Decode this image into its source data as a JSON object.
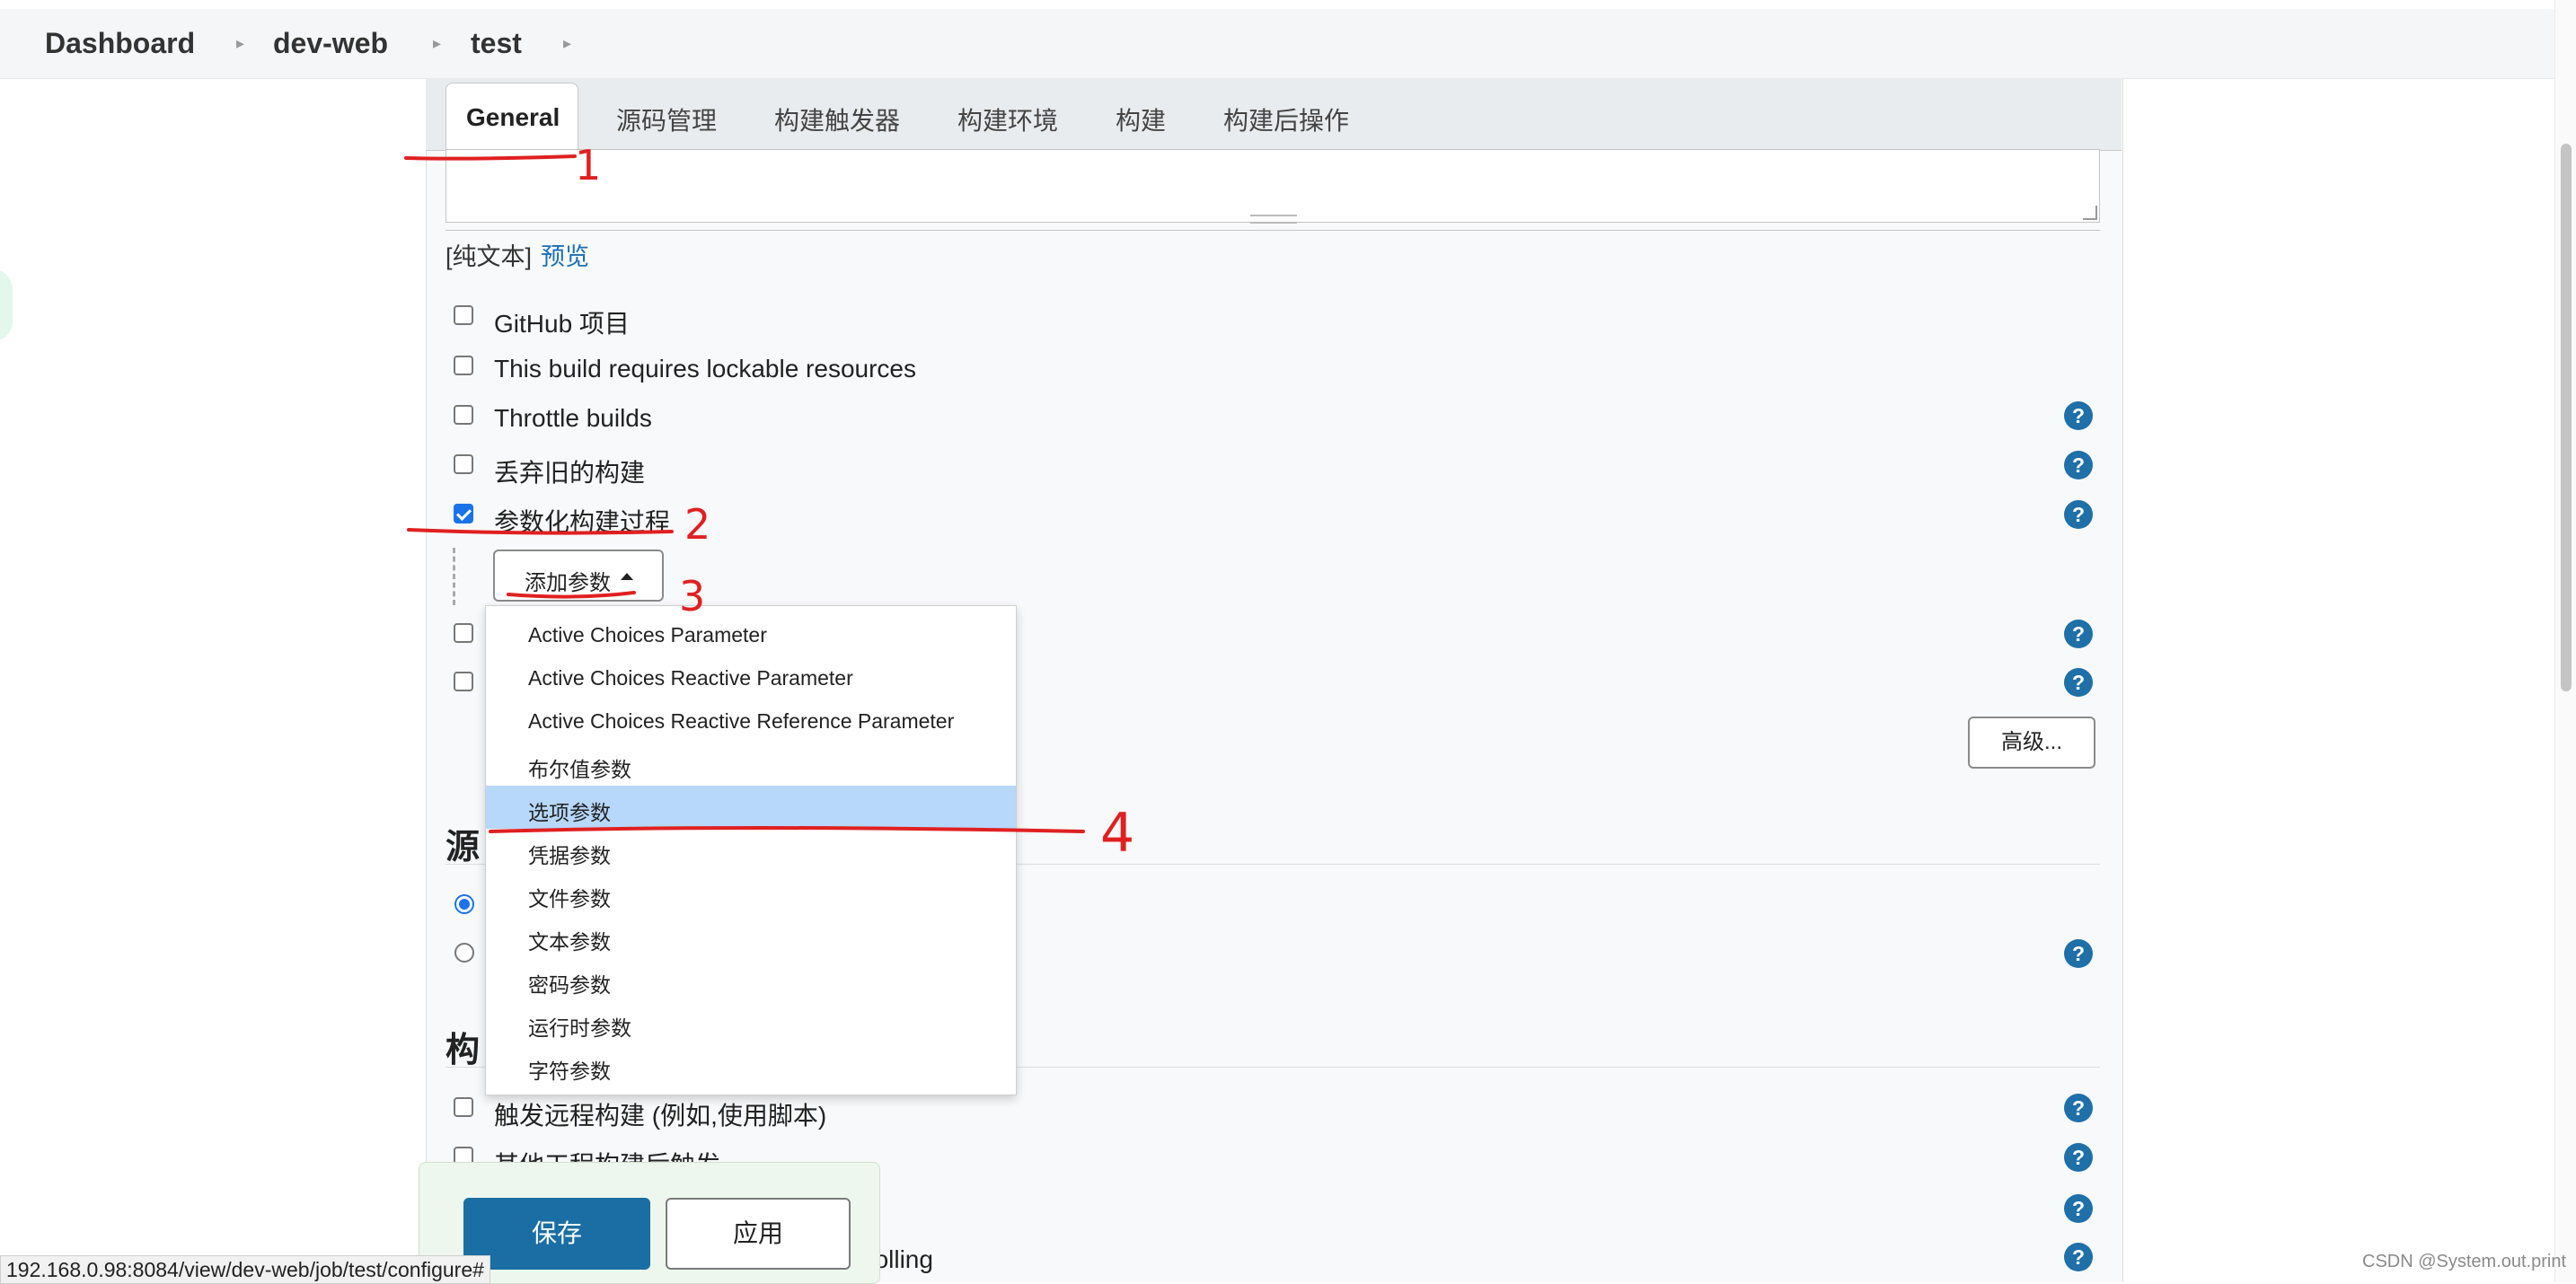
{
  "breadcrumb": {
    "items": [
      "Dashboard",
      "dev-web",
      "test"
    ]
  },
  "tabs": [
    "General",
    "源码管理",
    "构建触发器",
    "构建环境",
    "构建",
    "构建后操作"
  ],
  "description": {
    "plain_text_label": "[纯文本]",
    "preview_link": "预览"
  },
  "general_options": [
    {
      "label": "GitHub 项目",
      "checked": false,
      "help": false
    },
    {
      "label": "This build requires lockable resources",
      "checked": false,
      "help": false
    },
    {
      "label": "Throttle builds",
      "checked": false,
      "help": true
    },
    {
      "label": "丢弃旧的构建",
      "checked": false,
      "help": true
    },
    {
      "label": "参数化构建过程",
      "checked": true,
      "help": true
    }
  ],
  "add_parameter_button": "添加参数",
  "advanced_button": "高级...",
  "parameter_menu": {
    "items": [
      "Active Choices Parameter",
      "Active Choices Reactive Parameter",
      "Active Choices Reactive Reference Parameter",
      "布尔值参数",
      "选项参数",
      "凭据参数",
      "文件参数",
      "文本参数",
      "密码参数",
      "运行时参数",
      "字符参数"
    ],
    "selected": "选项参数"
  },
  "section_scm": {
    "title_visible": "源"
  },
  "section_triggers": {
    "title_visible": "构",
    "options": [
      {
        "label": "触发远程构建 (例如,使用脚本)",
        "checked": false
      },
      {
        "label": "其他工程构建后触发",
        "checked": false
      },
      {
        "label": "",
        "checked": false
      },
      {
        "label": "polling",
        "checked": false
      }
    ]
  },
  "buttons": {
    "save": "保存",
    "apply": "应用"
  },
  "status_bar": {
    "url": "192.168.0.98:8084/view/dev-web/job/test/configure#"
  },
  "watermark": "CSDN @System.out.print",
  "help_icon_glyph": "?",
  "annotations": [
    "1",
    "2",
    "3",
    "4"
  ],
  "colors": {
    "accent": "#1a73e8",
    "link": "#1b6fb5",
    "save": "#1a6ea3",
    "selected_item": "#b7d7fb",
    "annotation": "#e02020"
  }
}
